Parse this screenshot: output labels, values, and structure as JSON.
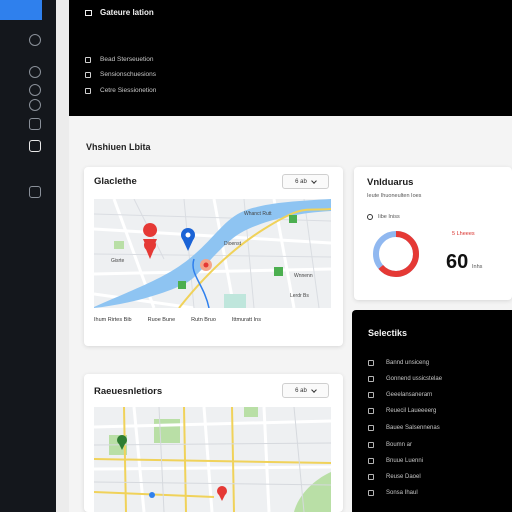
{
  "sidebar": {
    "icons": [
      "help-icon",
      "person-icon",
      "settings-icon",
      "globe-icon",
      "calendar-icon",
      "layers-icon",
      "chat-icon"
    ]
  },
  "topbar": {
    "title": "Gateure lation",
    "items": [
      {
        "icon": "list-icon",
        "label": "Bead Sterseuetion"
      },
      {
        "icon": "flag-icon",
        "label": "Sensionschuesions"
      },
      {
        "icon": "grid-icon",
        "label": "Cetre Siessionetion"
      }
    ]
  },
  "page": {
    "section_title": "Vhshiuen Lbita"
  },
  "map_card_1": {
    "title": "Glaclethe",
    "dropdown": "6 ab",
    "legend": [
      "Ihum Rirtes Bib",
      "Ruoe Bune",
      "Rutn Bruo",
      "Ittmuratt Ins"
    ],
    "labels": [
      "Gisrte",
      "Whanct Rutt",
      "Wnnenn",
      "Dioenst",
      "Lerdr Bs"
    ]
  },
  "stats_card": {
    "title": "Vnlduarus",
    "subtitle": "Ieute Ihuoneulten Ioes",
    "legend_label": "Iibe Iniss",
    "red_label": "5 Lheees",
    "value": "60",
    "value_unit": "Inhs",
    "donut_colors": {
      "primary": "#e53935",
      "secondary": "#90b8f0"
    }
  },
  "map_card_2": {
    "title": "Raeuesnletiors",
    "dropdown": "6 ab"
  },
  "dark_panel": {
    "title": "Selectiks",
    "items": [
      "Bannd unsiceng",
      "Gonnend ussicstelae",
      "Geeelansanerarn",
      "Reuecil Laueeeerg",
      "Bauee Salsennenas",
      "Boumn ar",
      "Bnuue Luenni",
      "Reuse Daoel",
      "Sonsa Ihaul"
    ]
  },
  "colors": {
    "accent_blue": "#2f80ed",
    "river": "#7eb8ee",
    "park": "#b9dfa6",
    "road_yellow": "#f0d25a",
    "pin_blue": "#1a63d6",
    "pin_red": "#e53935"
  }
}
